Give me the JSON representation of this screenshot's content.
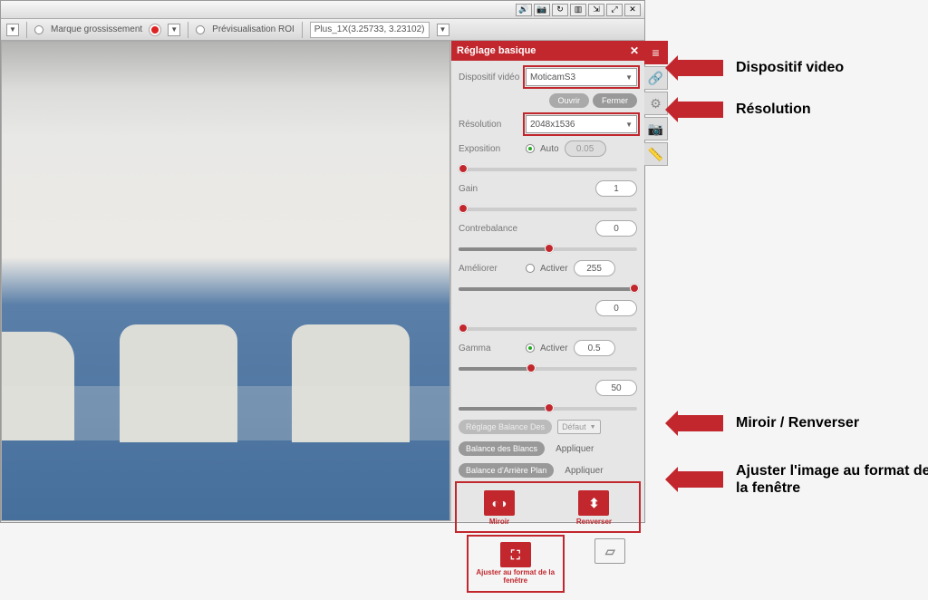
{
  "titlebar": {
    "icons": [
      "audio",
      "camera",
      "refresh",
      "columns",
      "expand",
      "minimize",
      "close"
    ]
  },
  "toolbar": {
    "marque_label": "Marque grossissement",
    "roi_label": "Prévisualisation ROI",
    "lens_combo": "Plus_1X(3.25733, 3.23102)"
  },
  "panel": {
    "title": "Réglage basique",
    "device_label": "Dispositif vidéo",
    "device_value": "MoticamS3",
    "open_btn": "Ouvrir",
    "close_btn": "Fermer",
    "resolution_label": "Résolution",
    "resolution_value": "2048x1536",
    "exposure_label": "Exposition",
    "exposure_auto": "Auto",
    "exposure_value": "0.05",
    "gain_label": "Gain",
    "gain_value": "1",
    "offset_label": "Contrebalance",
    "offset_value": "0",
    "enhance_label": "Améliorer",
    "enhance_activate": "Activer",
    "enhance_value": "255",
    "enhance2_value": "0",
    "gamma_label": "Gamma",
    "gamma_activate": "Activer",
    "gamma_value": "0.5",
    "gamma2_value": "50",
    "wb_region_label": "Réglage Balance Des",
    "wb_default": "Défaut",
    "wb_white_label": "Balance des Blancs",
    "wb_apply": "Appliquer",
    "wb_bg_label": "Balance d'Arrière Plan",
    "mirror_label": "Miroir",
    "flip_label": "Renverser",
    "fit_label": "Ajuster au format de la fenêtre"
  },
  "vtabs": [
    "sliders",
    "link",
    "gear",
    "camera",
    "ruler"
  ],
  "annotations": {
    "device": "Dispositif video",
    "resolution": "Résolution",
    "mirror": "Miroir / Renverser",
    "fit": "Ajuster l'image au format de la fenêtre"
  }
}
